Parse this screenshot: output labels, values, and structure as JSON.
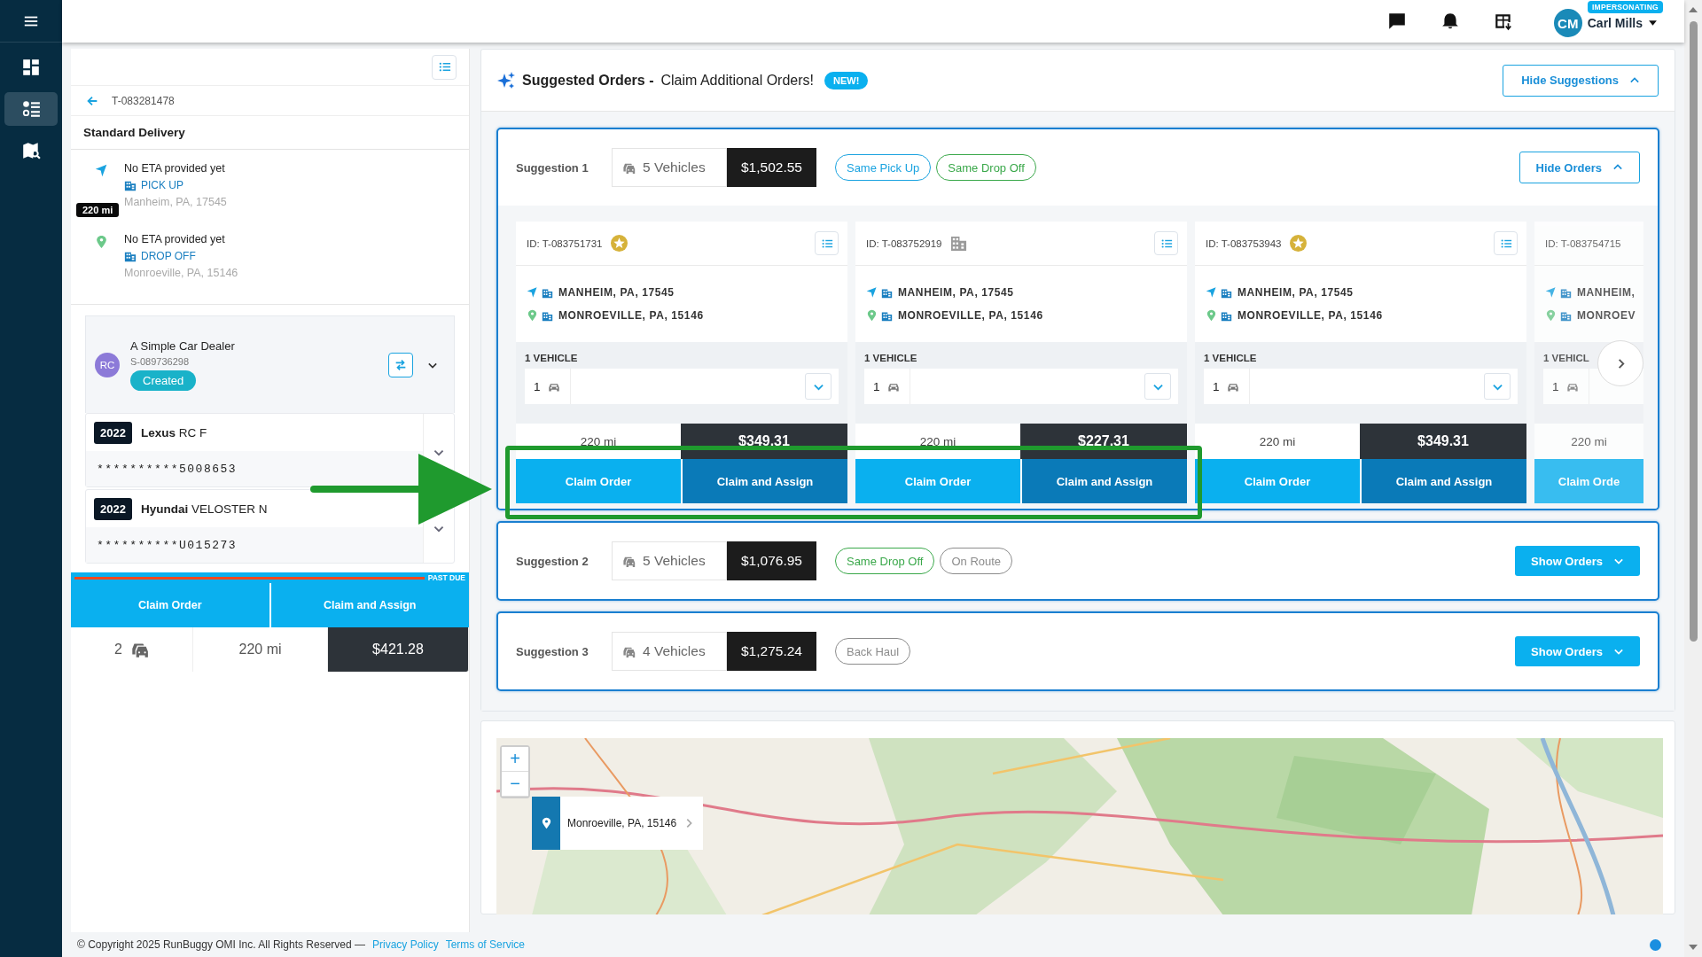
{
  "nav": {
    "items": [
      {
        "kind": "dashboard",
        "selected": false
      },
      {
        "kind": "list",
        "selected": true
      },
      {
        "kind": "map",
        "selected": false
      }
    ]
  },
  "top_bar": {
    "user": {
      "initials": "CM",
      "name": "Carl Mills",
      "badge": "IMPERSONATING"
    }
  },
  "order_panel": {
    "order_id": "T-083281478",
    "service": "Standard Delivery",
    "distance": "220 mi",
    "stops": [
      {
        "kind": "pickup",
        "eta": "No ETA provided yet",
        "label": "PICK UP",
        "address": "Manheim, PA, 17545"
      },
      {
        "kind": "dropoff",
        "eta": "No ETA provided yet",
        "label": "DROP OFF",
        "address": "Monroeville, PA, 15146"
      }
    ],
    "customer": {
      "initials": "RC",
      "name": "A Simple Car Dealer",
      "id": "S-089736298",
      "status": "Created"
    },
    "vehicles": [
      {
        "year": "2022",
        "make": "Lexus",
        "model": "RC F",
        "vin": "**********5008653"
      },
      {
        "year": "2022",
        "make": "Hyundai",
        "model": "VELOSTER N",
        "vin": "**********U015273"
      }
    ],
    "past_due": "PAST DUE",
    "buttons": [
      "Claim Order",
      "Claim and Assign"
    ],
    "summary": {
      "count": "2",
      "distance": "220 mi",
      "price": "$421.28"
    }
  },
  "suggestions": {
    "title": "Suggested Orders -",
    "subtitle": "Claim Additional Orders!",
    "badge": "NEW!",
    "toggle": "Hide Suggestions",
    "groups": [
      {
        "label": "Suggestion 1",
        "vehicles": "5 Vehicles",
        "price": "$1,502.55",
        "expanded": true,
        "toggle": "Hide Orders",
        "tags": [
          {
            "text": "Same Pick Up",
            "color": "#1aa3e0"
          },
          {
            "text": "Same Drop Off",
            "color": "#3aa84a"
          }
        ],
        "orders": [
          {
            "kind": "full",
            "id": "ID: T-083751731",
            "starred": true,
            "pickup": "MANHEIM, PA, 17545",
            "dropoff": "MONROEVILLE, PA, 15146",
            "vehicles_label": "1 VEHICLE",
            "count": "1",
            "distance": "220 mi",
            "price": "$349.31",
            "buttons": [
              "Claim Order",
              "Claim and Assign"
            ]
          },
          {
            "kind": "full",
            "id": "ID: T-083752919",
            "starred": false,
            "pickup": "MANHEIM, PA, 17545",
            "dropoff": "MONROEVILLE, PA, 15146",
            "vehicles_label": "1 VEHICLE",
            "count": "1",
            "distance": "220 mi",
            "price": "$227.31",
            "buttons": [
              "Claim Order",
              "Claim and Assign"
            ]
          },
          {
            "kind": "full",
            "id": "ID: T-083753943",
            "starred": true,
            "pickup": "MANHEIM, PA, 17545",
            "dropoff": "MONROEVILLE, PA, 15146",
            "vehicles_label": "1 VEHICLE",
            "count": "1",
            "distance": "220 mi",
            "price": "$349.31",
            "buttons": [
              "Claim Order",
              "Claim and Assign"
            ]
          },
          {
            "kind": "partial",
            "id": "ID: T-083754715",
            "pickup": "MANHEIM,",
            "dropoff": "MONROEV",
            "vehicles_label": "1 VEHICL",
            "count": "1",
            "distance": "220 mi",
            "buttons": [
              "Claim Orde"
            ]
          }
        ]
      },
      {
        "label": "Suggestion 2",
        "vehicles": "5 Vehicles",
        "price": "$1,076.95",
        "expanded": false,
        "toggle": "Show Orders",
        "tags": [
          {
            "text": "Same Drop Off",
            "color": "#3aa84a"
          },
          {
            "text": "On Route",
            "color": "#8c8c8c"
          }
        ]
      },
      {
        "label": "Suggestion 3",
        "vehicles": "4 Vehicles",
        "price": "$1,275.24",
        "expanded": false,
        "toggle": "Show Orders",
        "tags": [
          {
            "text": "Back Haul",
            "color": "#8c8c8c"
          }
        ]
      }
    ]
  },
  "map": {
    "kind": "picture",
    "zoom_in": "+",
    "zoom_out": "−",
    "location": "Monroeville, PA, 15146"
  },
  "footer": {
    "copyright": "© Copyright 2025 RunBuggy OMI Inc. All Rights Reserved —",
    "links": [
      "Privacy Policy",
      "Terms of Service"
    ]
  }
}
